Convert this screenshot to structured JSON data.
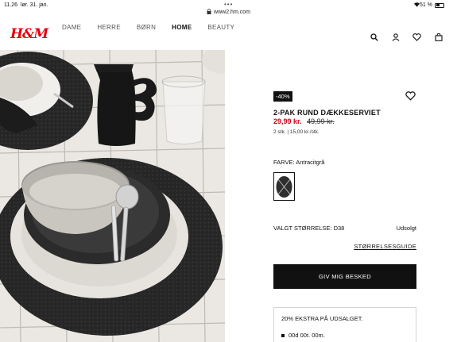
{
  "status_bar": {
    "time": "11.26",
    "date": "lør. 31. jan.",
    "battery": "51 %",
    "battery_level": 0.51,
    "url": "www2.hm.com"
  },
  "header": {
    "logo": "H&M",
    "brand_color": "#e50010",
    "nav": [
      {
        "label": "DAME",
        "active": false
      },
      {
        "label": "HERRE",
        "active": false
      },
      {
        "label": "BØRN",
        "active": false
      },
      {
        "label": "HOME",
        "active": true
      },
      {
        "label": "BEAUTY",
        "active": false
      }
    ],
    "icons": [
      "search-icon",
      "account-icon",
      "favorites-icon",
      "bag-icon"
    ]
  },
  "product": {
    "discount_badge": "-40%",
    "title": "2-PAK RUND DÆKKESERVIET",
    "price_sale": "29,99 kr.",
    "price_old": "49,99 kr.",
    "sale_color": "#d6001c",
    "unit_info": "2 stk. | 15,00 kr./stk.",
    "color_label": "FARVE: Antracitgrå",
    "size_label": "VALGT STØRRELSE: D38",
    "availability": "Udsolgt",
    "size_guide": "STØRRELSESGUIDE",
    "notify_button": "GIV MIG BESKED"
  },
  "promo": {
    "title": "20% EKSTRA PÅ UDSALGET.",
    "countdown": "00d 00t. 00m."
  }
}
